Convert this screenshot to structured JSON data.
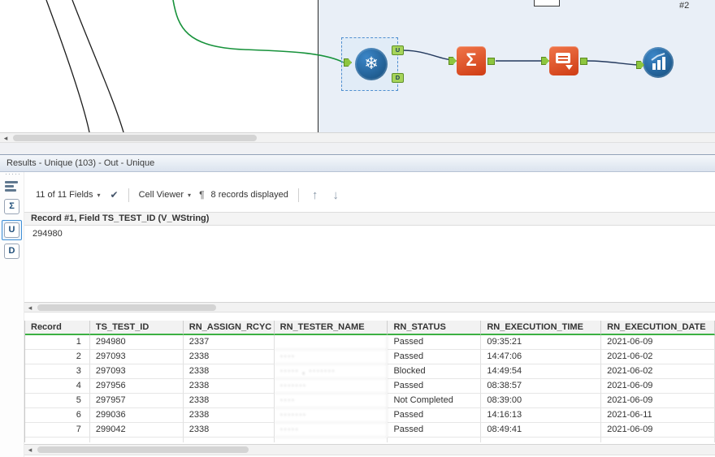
{
  "canvas": {
    "annotation": "#2",
    "unique_anchor_labels": {
      "u": "U",
      "d": "D"
    }
  },
  "icons": {
    "snowflake": "❄",
    "sigma": "Σ",
    "caret_down": "▾",
    "check": "✔",
    "pilcrow": "¶",
    "arrow_up": "↑",
    "arrow_down": "↓",
    "scroll_left": "◂",
    "grip_dots": "·····"
  },
  "results_panel": {
    "title": "Results - Unique (103) - Out - Unique",
    "sidebar": {
      "sigma_label": "Σ",
      "u_label": "U",
      "d_label": "D"
    },
    "toolbar": {
      "fields_selector": "11 of 11 Fields",
      "cell_viewer_label": "Cell Viewer",
      "records_displayed": "8 records displayed"
    },
    "cell_viewer": {
      "header": "Record #1, Field TS_TEST_ID (V_WString)",
      "value": "294980"
    },
    "table": {
      "columns": [
        "Record",
        "TS_TEST_ID",
        "RN_ASSIGN_RCYC",
        "RN_TESTER_NAME",
        "RN_STATUS",
        "RN_EXECUTION_TIME",
        "RN_EXECUTION_DATE"
      ],
      "rows": [
        {
          "record": "1",
          "test_id": "294980",
          "rcyc": "2337",
          "tester": "",
          "status": "Passed",
          "time": "09:35:21",
          "date": "2021-06-09"
        },
        {
          "record": "2",
          "test_id": "297093",
          "rcyc": "2338",
          "tester": "····",
          "status": "Passed",
          "time": "14:47:06",
          "date": "2021-06-02"
        },
        {
          "record": "3",
          "test_id": "297093",
          "rcyc": "2338",
          "tester": "····· , ·······",
          "status": "Blocked",
          "time": "14:49:54",
          "date": "2021-06-02"
        },
        {
          "record": "4",
          "test_id": "297956",
          "rcyc": "2338",
          "tester": "·······",
          "status": "Passed",
          "time": "08:38:57",
          "date": "2021-06-09"
        },
        {
          "record": "5",
          "test_id": "297957",
          "rcyc": "2338",
          "tester": "····",
          "status": "Not Completed",
          "time": "08:39:00",
          "date": "2021-06-09"
        },
        {
          "record": "6",
          "test_id": "299036",
          "rcyc": "2338",
          "tester": "·······",
          "status": "Passed",
          "time": "14:16:13",
          "date": "2021-06-11"
        },
        {
          "record": "7",
          "test_id": "299042",
          "rcyc": "2338",
          "tester": "·····",
          "status": "Passed",
          "time": "08:49:41",
          "date": "2021-06-09"
        }
      ]
    }
  },
  "colors": {
    "header_accent_green": "#3cb043",
    "tool_orange": "#d84315",
    "tool_blue": "#1b5e9e",
    "anchor_green": "#8dc63f",
    "selection_blue": "#4f8fd0",
    "wire_green": "#17923b"
  }
}
